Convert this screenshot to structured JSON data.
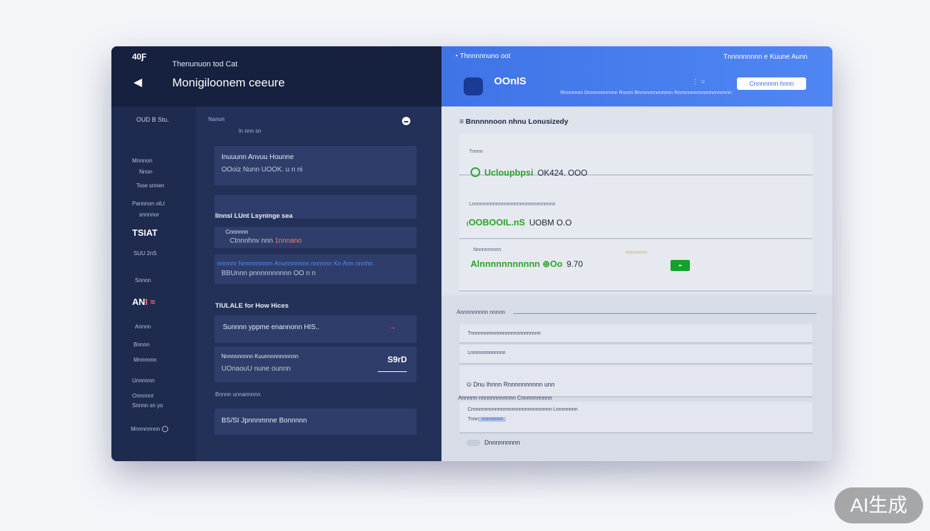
{
  "left": {
    "app_id": "40Ƒ",
    "subtitle": "Thenunuon tod Cat",
    "title": "Monigiloonem ceeure",
    "nav": [
      {
        "label": "OUD B Stu.",
        "style": "head"
      },
      {
        "label": "Mnnnon",
        "style": "small"
      },
      {
        "label": "Nnon",
        "style": "small"
      },
      {
        "label": "Tsse snnen",
        "style": "small"
      },
      {
        "label": "Pannnon oiLt",
        "style": "small"
      },
      {
        "label": "snnnnor",
        "style": "small"
      },
      {
        "label": "TSIAT",
        "style": "big"
      },
      {
        "label": "SUU 2nS",
        "style": "small"
      },
      {
        "label": "Snnnn",
        "style": "small"
      },
      {
        "label": "AN",
        "accent": "I ≈",
        "style": "big"
      },
      {
        "label": "Annnn",
        "style": "small"
      },
      {
        "label": "Bnnnn",
        "style": "small"
      },
      {
        "label": "Mnnnnnn",
        "style": "small"
      },
      {
        "label": "Unnnnnn",
        "style": "small"
      },
      {
        "label": "Onnnnnr",
        "style": "small"
      },
      {
        "label": "Snnnn sn yo",
        "style": "small"
      },
      {
        "label": "Mnnnnnnnn",
        "style": "small",
        "radio": true
      }
    ],
    "sect1_small": "Nanon",
    "sect1_small2": "ln nnn sn",
    "card1": {
      "line1": "Inuuunn Anvuu Hounne",
      "line2": "OOoiz Nunn UOOK. u n ni"
    },
    "sect2_head": "Ilnnsi LUnt Lsyninge sea",
    "card3": {
      "line1": "Cnnnnnn",
      "line2_a": "Ctnnnhnv nnn",
      "line2_b": "1nnnano"
    },
    "card4": {
      "line1": "nnnnnr Nnnnnnnnrn Anunnnnnnn nnnnnn Kn Ann nnnhn",
      "line2": "BBUnnn pnnnnnnnnnn OO n n"
    },
    "sect3_head": "TIULALE for How Hices",
    "card5": {
      "line1": "Sunnnn yppme enannonn HIS..",
      "chev": "→"
    },
    "card6": {
      "line1": "Nnnnnnnnnn Kuunnnnnnnnnnn",
      "line2": "UOnaouU nune ounnn",
      "price": "S9rD"
    },
    "sect4_small": "Bnnnn unnannnnn",
    "card7": {
      "line1": "BS/SI Jpnnnmnne Bonnnnn"
    }
  },
  "right": {
    "top_left": "Thnnnnnuno oot",
    "top_right": "Tnnnnnnnnn e Kuune Aunn",
    "brand": "OOnIS",
    "meta": "Rnnnnnnn  Onnnnnnnnnnn      Rnnnn Bnnnnnnnnnnnnn  Rnnnnnnnnnnnnnnnnnnnn",
    "dots": "⋮  ○",
    "button_label": "Cnnnnnnn hnnn",
    "heading": "Bnnnnnoon nhnu Lonusizedy",
    "row1": {
      "label": "Tnnnn",
      "value": "Ucloupbpsi",
      "dark": "OK424. OOO"
    },
    "row2": {
      "label": "Lnnnnnnnnnnnnnnnnnnnnnnnnnnnnnnn",
      "value": "₍OOBOOIL.nS",
      "dark": "UOBM O.O"
    },
    "row3": {
      "label": "Nnnnnnnnnn",
      "value": "Alnnnnnnnnnnn ⊕Oo",
      "dark": "9.70",
      "small": "nnnnnnnn"
    },
    "s2_title": "Annnnnnnnn nnnnn",
    "s2_rows": [
      {
        "t": "Tnnnnnnnnnnnnnnnnnnnnnnnnnn"
      },
      {
        "t": "Lnnnnnnnnnnnnn"
      },
      {
        "t2": "Dnu lhnnn Rnnnnnnnnnn unn"
      }
    ],
    "s2b_title": "Annnnn nnnnnnnnnnnn Cnnnnnnnnnn",
    "s2b_row_a": "Cnnnnnnnnnnnnnnnnnnnnnnnnnnnnnn  Lnnnnnnnn",
    "s2b_row_b_prefix": "Tnnn",
    "s2b_row_b_badge": "nnnnnnnn",
    "footer_label": "Dnnnnnnnnn"
  },
  "watermark": "AI生成"
}
